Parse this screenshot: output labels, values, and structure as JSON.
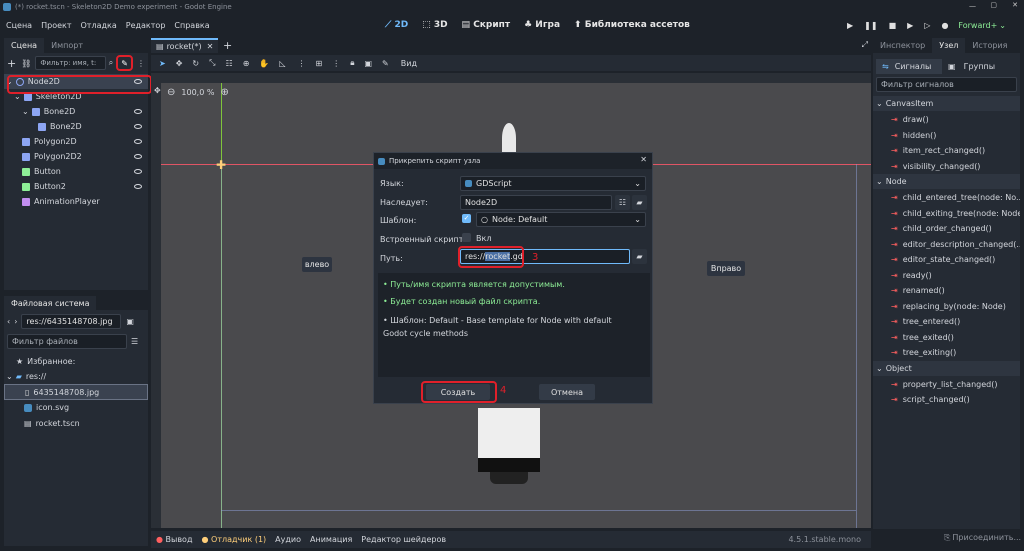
{
  "window": {
    "title": "(*) rocket.tscn - Skeleton2D Demo experiment - Godot Engine"
  },
  "menu": [
    "Сцена",
    "Проект",
    "Отладка",
    "Редактор",
    "Справка"
  ],
  "workspaces": {
    "w2d": "2D",
    "w3d": "3D",
    "script": "Скрипт",
    "game": "Игра",
    "assetlib": "Библиотека ассетов"
  },
  "renderer": "Forward+",
  "scene_dock": {
    "tabs": [
      "Сцена",
      "Импорт"
    ],
    "filter_placeholder": "Фильтр: имя, t:",
    "nodes": [
      {
        "label": "Node2D",
        "icon": "circle-node-icon",
        "color": "#8da5f3"
      },
      {
        "label": "Skeleton2D",
        "icon": "skeleton-icon",
        "color": "#8da5f3"
      },
      {
        "label": "Bone2D",
        "icon": "bone-icon",
        "color": "#8da5f3"
      },
      {
        "label": "Bone2D",
        "icon": "bone-icon",
        "color": "#8da5f3"
      },
      {
        "label": "Polygon2D",
        "icon": "polygon-icon",
        "color": "#8da5f3"
      },
      {
        "label": "Polygon2D2",
        "icon": "polygon-icon",
        "color": "#8da5f3"
      },
      {
        "label": "Button",
        "icon": "button-icon",
        "color": "#8eef97"
      },
      {
        "label": "Button2",
        "icon": "button-icon",
        "color": "#8eef97"
      },
      {
        "label": "AnimationPlayer",
        "icon": "animation-icon",
        "color": "#c38ef1"
      }
    ]
  },
  "filesystem": {
    "title": "Файловая система",
    "path": "res://6435148708.jpg",
    "filter_placeholder": "Фильтр файлов",
    "favorites": "Избранное:",
    "root": "res://",
    "files": [
      "6435148708.jpg",
      "icon.svg",
      "rocket.tscn"
    ]
  },
  "editor": {
    "tab": "rocket(*)",
    "zoom": "100,0 %",
    "view_label": "Вид",
    "left_button": "влево",
    "right_button": "Вправо"
  },
  "dialog": {
    "title": "Прикрепить скрипт узла",
    "language_label": "Язык:",
    "language_value": "GDScript",
    "inherits_label": "Наследует:",
    "inherits_value": "Node2D",
    "template_label": "Шаблон:",
    "template_value": "Node: Default",
    "builtin_label": "Встроенный скрипт:",
    "builtin_value": "Вкл",
    "path_label": "Путь:",
    "path_prefix": "res://",
    "path_selected": "rocket",
    "path_suffix": ".gd",
    "msg1": "Путь/имя скрипта является допустимым.",
    "msg2": "Будет создан новый файл скрипта.",
    "msg3": "Шаблон: Default - Base template for Node with default Godot cycle methods",
    "create": "Создать",
    "cancel": "Отмена",
    "annotation3": "3",
    "annotation4": "4"
  },
  "bottom": {
    "items": [
      "Вывод",
      "Отладчик (1)",
      "Аудио",
      "Анимация",
      "Редактор шейдеров"
    ],
    "version": "4.5.1.stable.mono",
    "connect": "Присоединить..."
  },
  "inspector": {
    "tabs": [
      "Инспектор",
      "Узел",
      "История"
    ],
    "subtabs": {
      "signals": "Сигналы",
      "groups": "Группы"
    },
    "filter_placeholder": "Фильтр сигналов",
    "groups": [
      {
        "name": "CanvasItem",
        "signals": [
          "draw()",
          "hidden()",
          "item_rect_changed()",
          "visibility_changed()"
        ]
      },
      {
        "name": "Node",
        "signals": [
          "child_entered_tree(node: No...",
          "child_exiting_tree(node: Node)",
          "child_order_changed()",
          "editor_description_changed(...",
          "editor_state_changed()",
          "ready()",
          "renamed()",
          "replacing_by(node: Node)",
          "tree_entered()",
          "tree_exited()",
          "tree_exiting()"
        ]
      },
      {
        "name": "Object",
        "signals": [
          "property_list_changed()",
          "script_changed()"
        ]
      }
    ]
  },
  "colors": {
    "accent": "#70bafa",
    "highlight": "#e0202a",
    "valid": "#8eef97"
  }
}
